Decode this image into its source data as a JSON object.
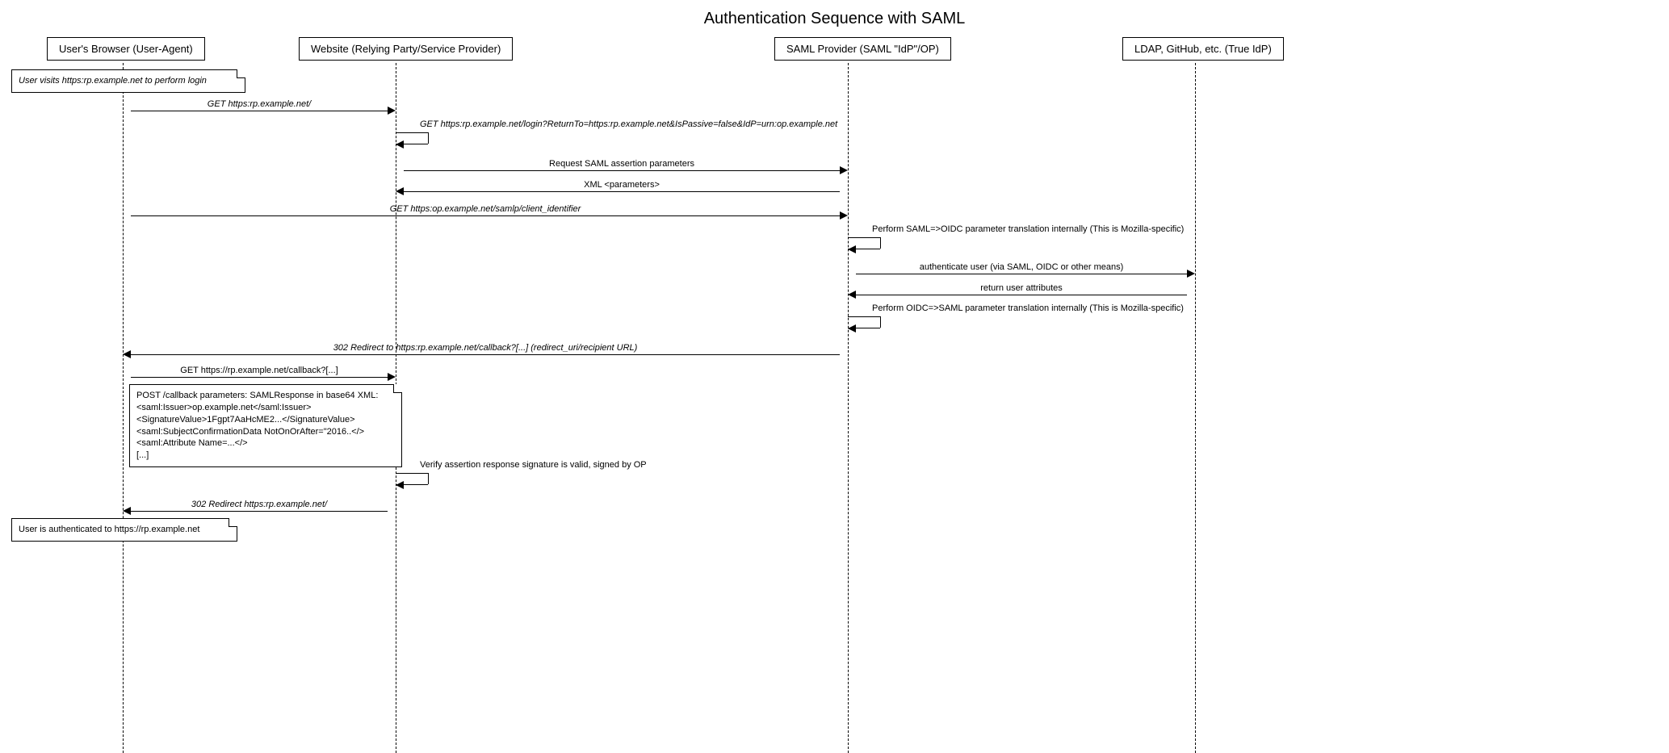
{
  "title": "Authentication Sequence with SAML",
  "participants": {
    "p1": "User's Browser (User-Agent)",
    "p2": "Website (Relying Party/Service Provider)",
    "p3": "SAML Provider (SAML \"IdP\"/OP)",
    "p4": "LDAP, GitHub, etc. (True IdP)"
  },
  "notes": {
    "n1": "User visits https:rp.example.net to perform login",
    "n2": "POST /callback parameters: SAMLResponse in base64 XML:\n<saml:Issuer>op.example.net</saml:Issuer>\n<SignatureValue>1Fgpt7AaHcME2...</SignatureValue>\n<saml:SubjectConfirmationData NotOnOrAfter=\"2016..</>\n<saml:Attribute Name=...</>\n[...]",
    "n3": "User is authenticated to https://rp.example.net"
  },
  "messages": {
    "m1": "GET https:rp.example.net/",
    "m2": "GET https:rp.example.net/login?ReturnTo=https:rp.example.net&IsPassive=false&IdP=urn:op.example.net",
    "m3": "Request SAML assertion parameters",
    "m4": "XML <parameters>",
    "m5": "GET https:op.example.net/samlp/client_identifier",
    "m6": "Perform SAML=>OIDC parameter translation internally (This is Mozilla-specific)",
    "m7": "authenticate user (via SAML, OIDC or other means)",
    "m8": "return user attributes",
    "m9": "Perform OIDC=>SAML parameter translation internally (This is Mozilla-specific)",
    "m10": "302 Redirect to https:rp.example.net/callback?[...] (redirect_uri/recipient URL)",
    "m11": "GET https://rp.example.net/callback?[...]",
    "m12": "Verify assertion response signature is valid, signed by OP",
    "m13": "302 Redirect https:rp.example.net/"
  }
}
